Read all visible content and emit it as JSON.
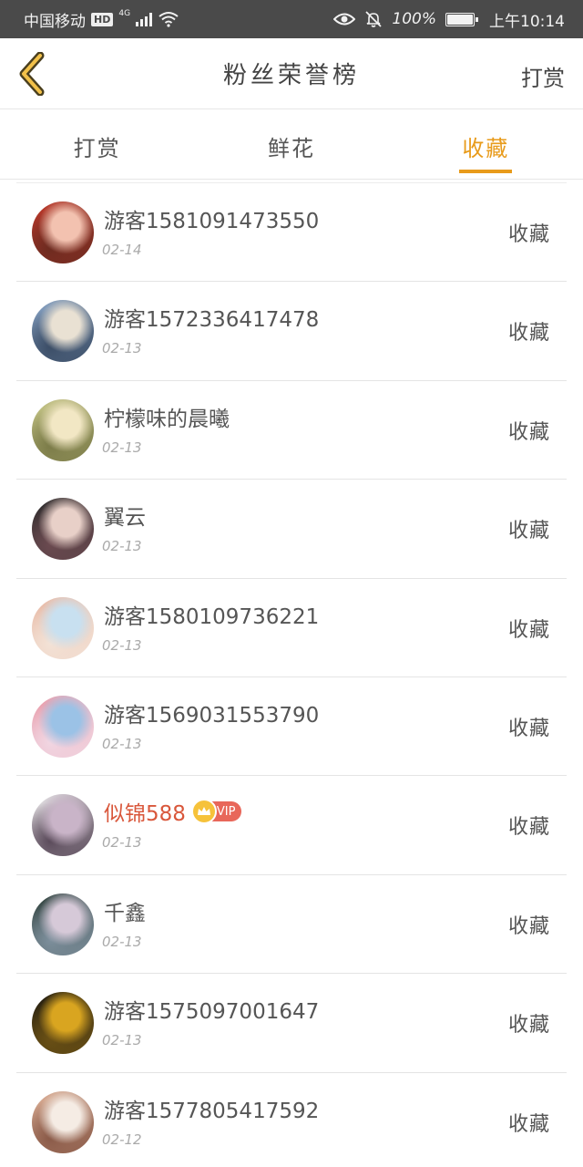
{
  "status_bar": {
    "carrier": "中国移动",
    "hd": "HD",
    "network": "4G",
    "battery_percent": "100%",
    "time": "上午10:14"
  },
  "nav": {
    "title": "粉丝荣誉榜",
    "action": "打赏"
  },
  "tabs": [
    {
      "label": "打赏",
      "active": false
    },
    {
      "label": "鲜花",
      "active": false
    },
    {
      "label": "收藏",
      "active": true
    }
  ],
  "list": [
    {
      "name": "游客1581091473550",
      "date": "02-14",
      "action": "收藏",
      "vip": false,
      "avatar_colors": [
        "#c0392b",
        "#f3c2b0",
        "#6d2b20"
      ]
    },
    {
      "name": "游客1572336417478",
      "date": "02-13",
      "action": "收藏",
      "vip": false,
      "avatar_colors": [
        "#8aa6c8",
        "#e9e1d3",
        "#3b4d66"
      ]
    },
    {
      "name": "柠檬味的晨曦",
      "date": "02-13",
      "action": "收藏",
      "vip": false,
      "avatar_colors": [
        "#c9c98a",
        "#f2e7c4",
        "#7b7b48"
      ]
    },
    {
      "name": "翼云",
      "date": "02-13",
      "action": "收藏",
      "vip": false,
      "avatar_colors": [
        "#2b2b2b",
        "#e8d0c8",
        "#6b4a50"
      ]
    },
    {
      "name": "游客1580109736221",
      "date": "02-13",
      "action": "收藏",
      "vip": false,
      "avatar_colors": [
        "#e7b8a4",
        "#c8e0f0",
        "#f3e2d6"
      ]
    },
    {
      "name": "游客1569031553790",
      "date": "02-13",
      "action": "收藏",
      "vip": false,
      "avatar_colors": [
        "#e89aa8",
        "#9bc2e6",
        "#f1d6e2"
      ]
    },
    {
      "name": "似锦588",
      "date": "02-13",
      "action": "收藏",
      "vip": true,
      "vip_label": "VIP",
      "avatar_colors": [
        "#f0eef0",
        "#c9b4c8",
        "#5a4a5a"
      ]
    },
    {
      "name": "千鑫",
      "date": "02-13",
      "action": "收藏",
      "vip": false,
      "avatar_colors": [
        "#2e3f3a",
        "#d6c9d8",
        "#7d8f9c"
      ]
    },
    {
      "name": "游客1575097001647",
      "date": "02-13",
      "action": "收藏",
      "vip": false,
      "avatar_colors": [
        "#1e1a10",
        "#d9a520",
        "#6a5015"
      ]
    },
    {
      "name": "游客1577805417592",
      "date": "02-12",
      "action": "收藏",
      "vip": false,
      "avatar_colors": [
        "#e0b39a",
        "#f5ece4",
        "#8a5a48"
      ]
    }
  ],
  "colors": {
    "accent": "#e89b1b",
    "vip_name": "#d9573b",
    "status_bar_bg": "#4a4a4a"
  }
}
